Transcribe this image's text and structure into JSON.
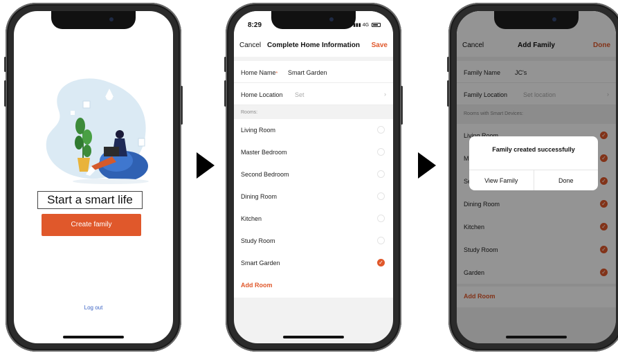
{
  "colors": {
    "accent": "#e0582b",
    "link": "#3b63c4"
  },
  "screen1": {
    "title": "Start a smart life",
    "create_button": "Create family",
    "logout": "Log out"
  },
  "screen2": {
    "status": {
      "time": "8:29",
      "network": "4G"
    },
    "nav": {
      "cancel": "Cancel",
      "title": "Complete Home Information",
      "save": "Save"
    },
    "home_name": {
      "label": "Home Name",
      "required_mark": "*",
      "value": "Smart Garden"
    },
    "home_location": {
      "label": "Home Location",
      "value": "Set"
    },
    "rooms_header": "Rooms:",
    "rooms": [
      {
        "name": "Living Room",
        "checked": false
      },
      {
        "name": "Master Bedroom",
        "checked": false
      },
      {
        "name": "Second Bedroom",
        "checked": false
      },
      {
        "name": "Dining Room",
        "checked": false
      },
      {
        "name": "Kitchen",
        "checked": false
      },
      {
        "name": "Study Room",
        "checked": false
      },
      {
        "name": "Smart Garden",
        "checked": true
      }
    ],
    "add_room": "Add Room"
  },
  "screen3": {
    "nav": {
      "cancel": "Cancel",
      "title": "Add Family",
      "done": "Done"
    },
    "family_name": {
      "label": "Family Name",
      "value": "JC's"
    },
    "family_location": {
      "label": "Family Location",
      "placeholder": "Set location"
    },
    "rooms_header": "Rooms with Smart Devices:",
    "rooms": [
      {
        "name": "Living Room",
        "checked": true
      },
      {
        "name": "M",
        "checked": true
      },
      {
        "name": "Se",
        "checked": true
      },
      {
        "name": "Dining Room",
        "checked": true
      },
      {
        "name": "Kitchen",
        "checked": true
      },
      {
        "name": "Study Room",
        "checked": true
      },
      {
        "name": "Garden",
        "checked": true
      }
    ],
    "add_room": "Add Room",
    "dialog": {
      "message": "Family created successfully",
      "view_family": "View Family",
      "done": "Done"
    }
  }
}
